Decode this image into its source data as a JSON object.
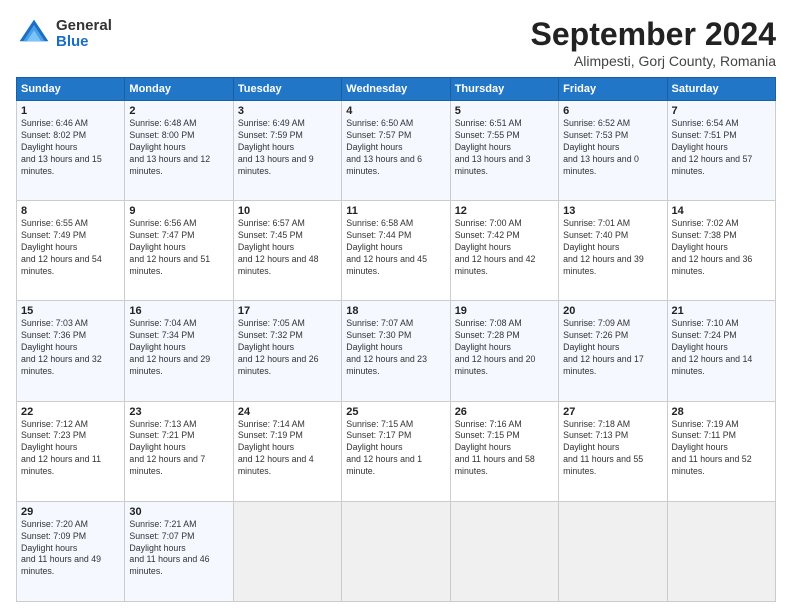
{
  "header": {
    "logo_general": "General",
    "logo_blue": "Blue",
    "title": "September 2024",
    "subtitle": "Alimpesti, Gorj County, Romania"
  },
  "weekdays": [
    "Sunday",
    "Monday",
    "Tuesday",
    "Wednesday",
    "Thursday",
    "Friday",
    "Saturday"
  ],
  "weeks": [
    [
      {
        "day": "1",
        "rise": "6:46 AM",
        "set": "8:02 PM",
        "daylight": "13 hours and 15 minutes."
      },
      {
        "day": "2",
        "rise": "6:48 AM",
        "set": "8:00 PM",
        "daylight": "13 hours and 12 minutes."
      },
      {
        "day": "3",
        "rise": "6:49 AM",
        "set": "7:59 PM",
        "daylight": "13 hours and 9 minutes."
      },
      {
        "day": "4",
        "rise": "6:50 AM",
        "set": "7:57 PM",
        "daylight": "13 hours and 6 minutes."
      },
      {
        "day": "5",
        "rise": "6:51 AM",
        "set": "7:55 PM",
        "daylight": "13 hours and 3 minutes."
      },
      {
        "day": "6",
        "rise": "6:52 AM",
        "set": "7:53 PM",
        "daylight": "13 hours and 0 minutes."
      },
      {
        "day": "7",
        "rise": "6:54 AM",
        "set": "7:51 PM",
        "daylight": "12 hours and 57 minutes."
      }
    ],
    [
      {
        "day": "8",
        "rise": "6:55 AM",
        "set": "7:49 PM",
        "daylight": "12 hours and 54 minutes."
      },
      {
        "day": "9",
        "rise": "6:56 AM",
        "set": "7:47 PM",
        "daylight": "12 hours and 51 minutes."
      },
      {
        "day": "10",
        "rise": "6:57 AM",
        "set": "7:45 PM",
        "daylight": "12 hours and 48 minutes."
      },
      {
        "day": "11",
        "rise": "6:58 AM",
        "set": "7:44 PM",
        "daylight": "12 hours and 45 minutes."
      },
      {
        "day": "12",
        "rise": "7:00 AM",
        "set": "7:42 PM",
        "daylight": "12 hours and 42 minutes."
      },
      {
        "day": "13",
        "rise": "7:01 AM",
        "set": "7:40 PM",
        "daylight": "12 hours and 39 minutes."
      },
      {
        "day": "14",
        "rise": "7:02 AM",
        "set": "7:38 PM",
        "daylight": "12 hours and 36 minutes."
      }
    ],
    [
      {
        "day": "15",
        "rise": "7:03 AM",
        "set": "7:36 PM",
        "daylight": "12 hours and 32 minutes."
      },
      {
        "day": "16",
        "rise": "7:04 AM",
        "set": "7:34 PM",
        "daylight": "12 hours and 29 minutes."
      },
      {
        "day": "17",
        "rise": "7:05 AM",
        "set": "7:32 PM",
        "daylight": "12 hours and 26 minutes."
      },
      {
        "day": "18",
        "rise": "7:07 AM",
        "set": "7:30 PM",
        "daylight": "12 hours and 23 minutes."
      },
      {
        "day": "19",
        "rise": "7:08 AM",
        "set": "7:28 PM",
        "daylight": "12 hours and 20 minutes."
      },
      {
        "day": "20",
        "rise": "7:09 AM",
        "set": "7:26 PM",
        "daylight": "12 hours and 17 minutes."
      },
      {
        "day": "21",
        "rise": "7:10 AM",
        "set": "7:24 PM",
        "daylight": "12 hours and 14 minutes."
      }
    ],
    [
      {
        "day": "22",
        "rise": "7:12 AM",
        "set": "7:23 PM",
        "daylight": "12 hours and 11 minutes."
      },
      {
        "day": "23",
        "rise": "7:13 AM",
        "set": "7:21 PM",
        "daylight": "12 hours and 7 minutes."
      },
      {
        "day": "24",
        "rise": "7:14 AM",
        "set": "7:19 PM",
        "daylight": "12 hours and 4 minutes."
      },
      {
        "day": "25",
        "rise": "7:15 AM",
        "set": "7:17 PM",
        "daylight": "12 hours and 1 minute."
      },
      {
        "day": "26",
        "rise": "7:16 AM",
        "set": "7:15 PM",
        "daylight": "11 hours and 58 minutes."
      },
      {
        "day": "27",
        "rise": "7:18 AM",
        "set": "7:13 PM",
        "daylight": "11 hours and 55 minutes."
      },
      {
        "day": "28",
        "rise": "7:19 AM",
        "set": "7:11 PM",
        "daylight": "11 hours and 52 minutes."
      }
    ],
    [
      {
        "day": "29",
        "rise": "7:20 AM",
        "set": "7:09 PM",
        "daylight": "11 hours and 49 minutes."
      },
      {
        "day": "30",
        "rise": "7:21 AM",
        "set": "7:07 PM",
        "daylight": "11 hours and 46 minutes."
      },
      null,
      null,
      null,
      null,
      null
    ]
  ]
}
